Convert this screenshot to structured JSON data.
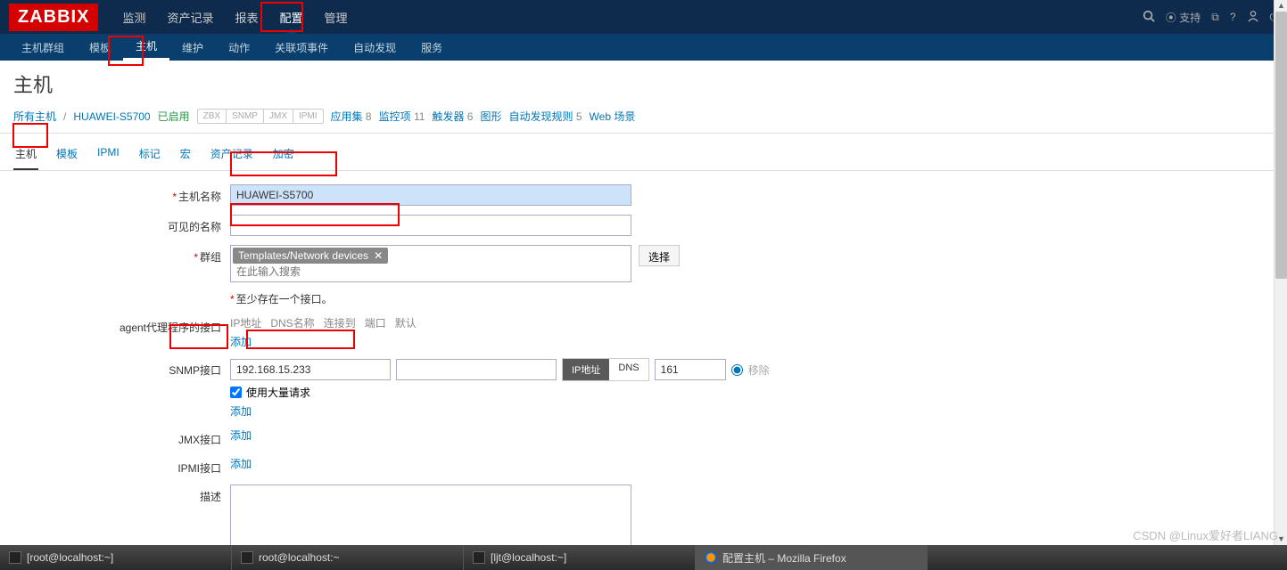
{
  "logo": "ZABBIX",
  "topnav": [
    "监测",
    "资产记录",
    "报表",
    "配置",
    "管理"
  ],
  "topnav_active": 3,
  "support_label": "支持",
  "subnav": [
    "主机群组",
    "模板",
    "主机",
    "维护",
    "动作",
    "关联项事件",
    "自动发现",
    "服务"
  ],
  "subnav_active": 2,
  "page_title": "主机",
  "breadcrumb": {
    "all_hosts": "所有主机",
    "host": "HUAWEI-S5700",
    "status": "已启用",
    "tags": [
      "ZBX",
      "SNMP",
      "JMX",
      "IPMI"
    ],
    "stats": [
      {
        "label": "应用集",
        "count": "8"
      },
      {
        "label": "监控项",
        "count": "11"
      },
      {
        "label": "触发器",
        "count": "6"
      },
      {
        "label": "图形",
        "count": ""
      },
      {
        "label": "自动发现规则",
        "count": "5"
      },
      {
        "label": "Web 场景",
        "count": ""
      }
    ]
  },
  "tabs": [
    "主机",
    "模板",
    "IPMI",
    "标记",
    "宏",
    "资产记录",
    "加密"
  ],
  "tabs_active": 0,
  "form": {
    "host_name_label": "主机名称",
    "host_name_value": "HUAWEI-S5700",
    "visible_name_label": "可见的名称",
    "visible_name_value": "",
    "groups_label": "群组",
    "group_chip": "Templates/Network devices",
    "group_placeholder": "在此输入搜索",
    "select_btn": "选择",
    "min_iface_hint": "至少存在一个接口。",
    "agent_label": "agent代理程序的接口",
    "iface_headers": [
      "IP地址",
      "DNS名称",
      "连接到",
      "端口",
      "默认"
    ],
    "add_link": "添加",
    "snmp_label": "SNMP接口",
    "snmp_ip": "192.168.15.233",
    "snmp_dns": "",
    "snmp_toggle_ip": "IP地址",
    "snmp_toggle_dns": "DNS",
    "snmp_port": "161",
    "remove_link": "移除",
    "bulk_label": "使用大量请求",
    "jmx_label": "JMX接口",
    "ipmi_label": "IPMI接口",
    "desc_label": "描述",
    "desc_value": ""
  },
  "taskbar": {
    "t1": "[root@localhost:~]",
    "t2": "root@localhost:~",
    "t3": "[ljt@localhost:~]",
    "t4": "配置主机 – Mozilla Firefox"
  },
  "watermark": "CSDN @Linux爱好者LIANG"
}
